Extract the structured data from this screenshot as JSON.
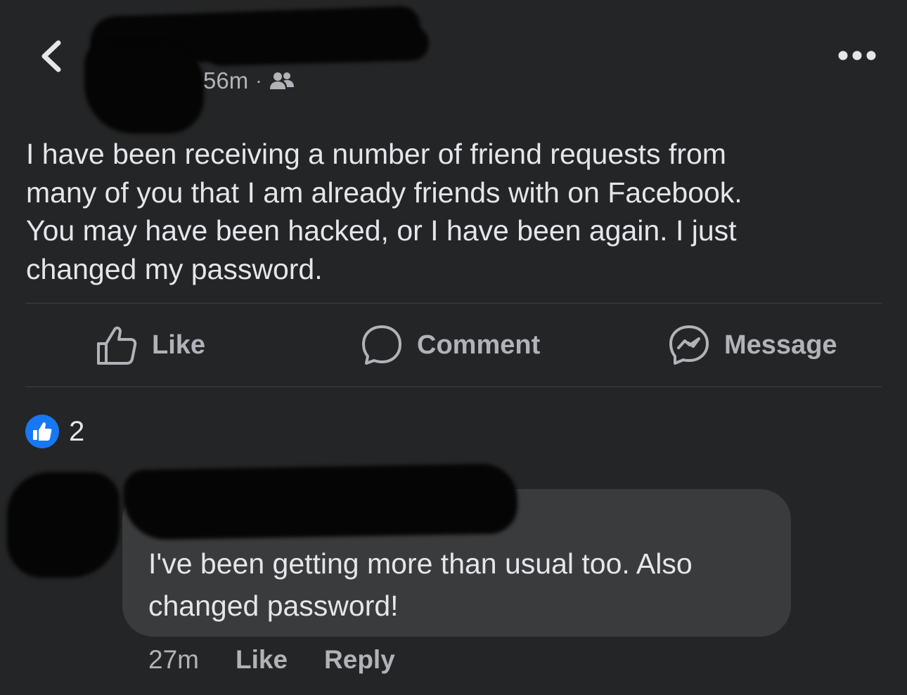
{
  "header": {
    "timestamp": "56m",
    "separator": "·",
    "audience_icon": "friends-icon",
    "back_icon": "chevron-left-icon",
    "more_icon": "more-dots-icon"
  },
  "post": {
    "text": "I have been receiving a number of friend requests from\nmany of you that I am already friends with on Facebook.\nYou may have been hacked, or I have been again. I just\nchanged my password."
  },
  "actions": {
    "like_label": "Like",
    "comment_label": "Comment",
    "message_label": "Message",
    "like_icon": "thumbs-up-icon",
    "comment_icon": "comment-bubble-icon",
    "message_icon": "messenger-icon"
  },
  "reactions": {
    "count": "2",
    "icon": "like-reaction-icon"
  },
  "comment": {
    "text": "I've been getting more than usual too. Also changed password!",
    "time": "27m",
    "like_label": "Like",
    "reply_label": "Reply"
  },
  "colors": {
    "background": "#242526",
    "text_primary": "#e4e6eb",
    "text_secondary": "#b0b3b8",
    "bubble": "#3a3b3c",
    "like_blue": "#1877f2",
    "divider": "#3e4042"
  }
}
